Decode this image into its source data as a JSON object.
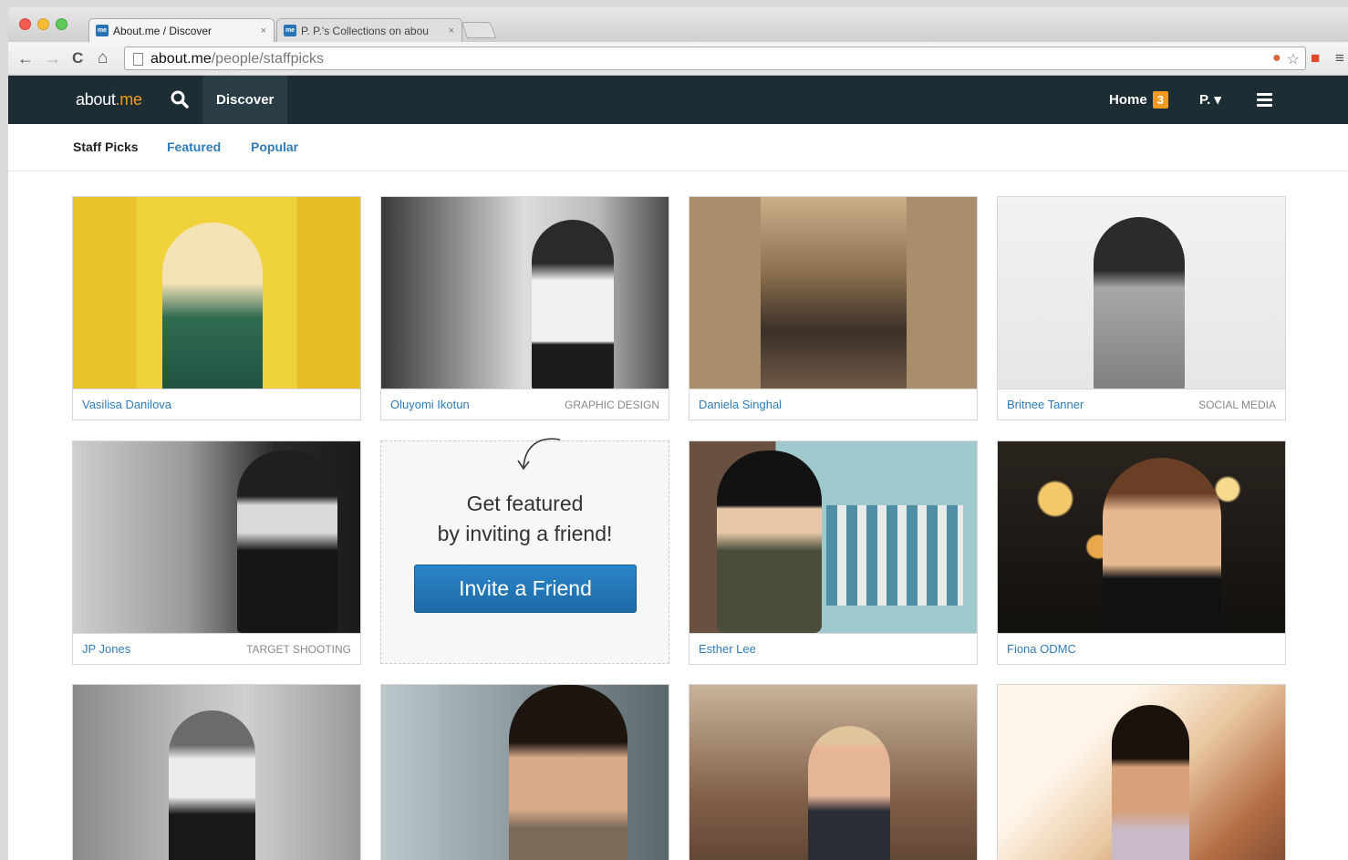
{
  "browser": {
    "tabs": [
      {
        "favicon": "me",
        "title": "About.me / Discover",
        "close": "×"
      },
      {
        "favicon": "me",
        "title": "P. P.'s Collections on abou",
        "close": "×"
      }
    ],
    "url_host": "about.me",
    "url_path": "/people/staffpicks",
    "icons": {
      "back": "←",
      "forward": "→",
      "reload": "C",
      "home": "⌂",
      "star": "☆",
      "menu": "≡"
    }
  },
  "site_nav": {
    "logo_prefix": "about",
    "logo_suffix": ".me",
    "discover_label": "Discover",
    "home_label": "Home",
    "home_badge": "3",
    "user_label": "P. ▾"
  },
  "sub_nav": {
    "items": [
      "Staff Picks",
      "Featured",
      "Popular"
    ]
  },
  "invite": {
    "line1": "Get featured",
    "line2": "by inviting a friend!",
    "button_label": "Invite a Friend"
  },
  "cards": [
    {
      "name": "Vasilisa Danilova",
      "tag": ""
    },
    {
      "name": "Oluyomi Ikotun",
      "tag": "GRAPHIC DESIGN"
    },
    {
      "name": "Daniela Singhal",
      "tag": ""
    },
    {
      "name": "Britnee Tanner",
      "tag": "SOCIAL MEDIA"
    },
    {
      "name": "JP Jones",
      "tag": "TARGET SHOOTING"
    },
    {
      "name": "Esther Lee",
      "tag": ""
    },
    {
      "name": "Fiona ODMC",
      "tag": ""
    }
  ]
}
